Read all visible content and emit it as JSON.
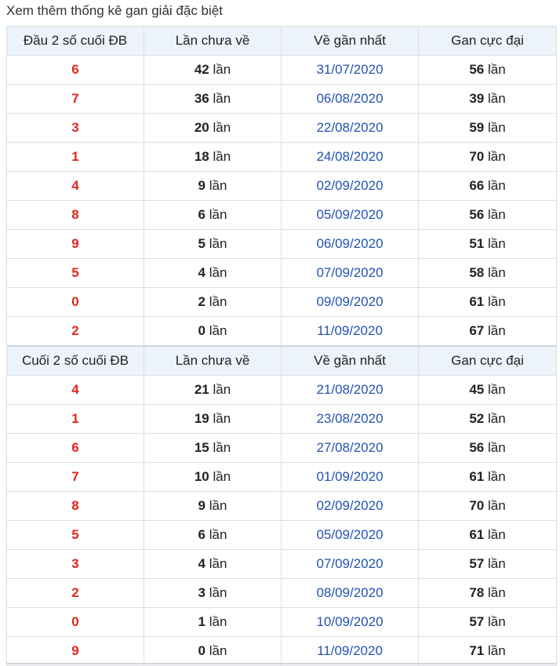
{
  "caption": "Xem thêm thống kê gan giải đặc biệt",
  "unit": "lần",
  "head_table": {
    "headers": [
      "Đầu 2 số cuối ĐB",
      "Lần chưa về",
      "Về gần nhất",
      "Gan cực đại"
    ],
    "rows": [
      {
        "digit": "6",
        "count": "42",
        "date": "31/07/2020",
        "max": "56"
      },
      {
        "digit": "7",
        "count": "36",
        "date": "06/08/2020",
        "max": "39"
      },
      {
        "digit": "3",
        "count": "20",
        "date": "22/08/2020",
        "max": "59"
      },
      {
        "digit": "1",
        "count": "18",
        "date": "24/08/2020",
        "max": "70"
      },
      {
        "digit": "4",
        "count": "9",
        "date": "02/09/2020",
        "max": "66"
      },
      {
        "digit": "8",
        "count": "6",
        "date": "05/09/2020",
        "max": "56"
      },
      {
        "digit": "9",
        "count": "5",
        "date": "06/09/2020",
        "max": "51"
      },
      {
        "digit": "5",
        "count": "4",
        "date": "07/09/2020",
        "max": "58"
      },
      {
        "digit": "0",
        "count": "2",
        "date": "09/09/2020",
        "max": "61"
      },
      {
        "digit": "2",
        "count": "0",
        "date": "11/09/2020",
        "max": "67"
      }
    ]
  },
  "tail_table": {
    "headers": [
      "Cuối 2 số cuối ĐB",
      "Lần chưa về",
      "Về gần nhất",
      "Gan cực đại"
    ],
    "rows": [
      {
        "digit": "4",
        "count": "21",
        "date": "21/08/2020",
        "max": "45"
      },
      {
        "digit": "1",
        "count": "19",
        "date": "23/08/2020",
        "max": "52"
      },
      {
        "digit": "6",
        "count": "15",
        "date": "27/08/2020",
        "max": "56"
      },
      {
        "digit": "7",
        "count": "10",
        "date": "01/09/2020",
        "max": "61"
      },
      {
        "digit": "8",
        "count": "9",
        "date": "02/09/2020",
        "max": "70"
      },
      {
        "digit": "5",
        "count": "6",
        "date": "05/09/2020",
        "max": "61"
      },
      {
        "digit": "3",
        "count": "4",
        "date": "07/09/2020",
        "max": "57"
      },
      {
        "digit": "2",
        "count": "3",
        "date": "08/09/2020",
        "max": "78"
      },
      {
        "digit": "0",
        "count": "1",
        "date": "10/09/2020",
        "max": "57"
      },
      {
        "digit": "9",
        "count": "0",
        "date": "11/09/2020",
        "max": "71"
      }
    ]
  }
}
